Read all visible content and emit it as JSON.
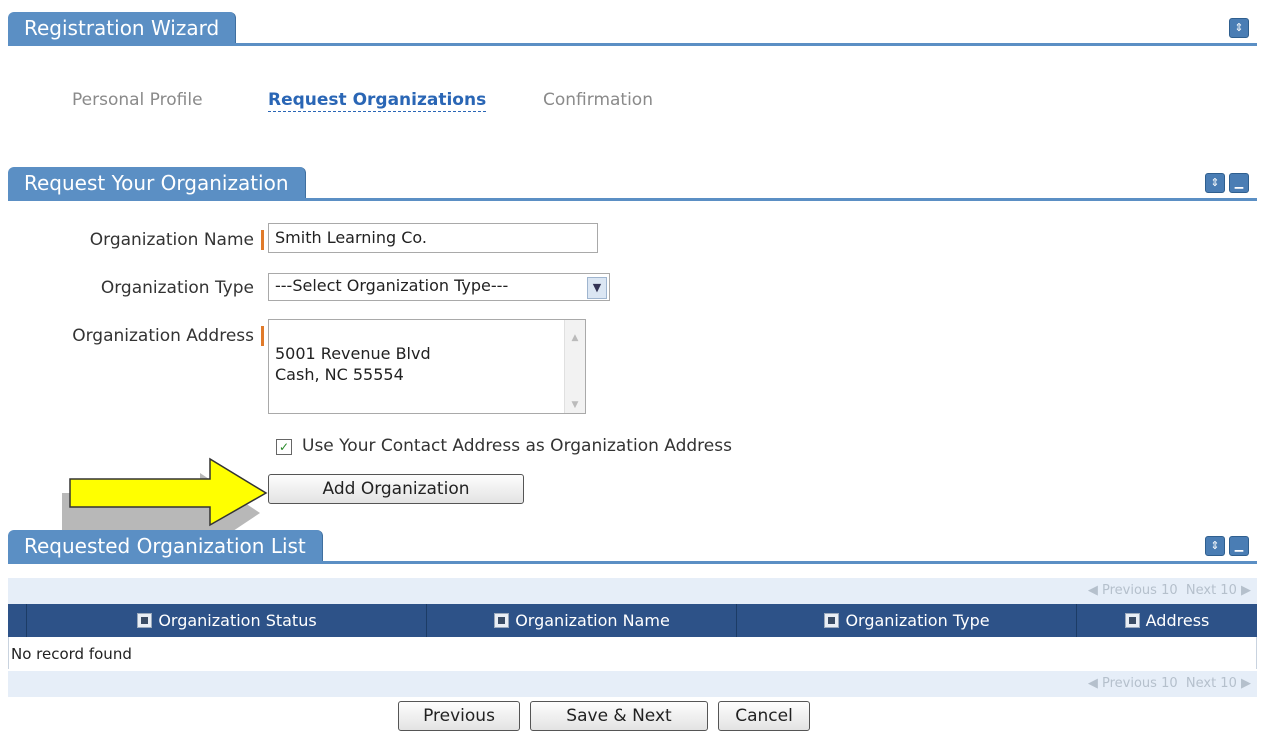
{
  "wizard": {
    "title": "Registration Wizard"
  },
  "steps": [
    {
      "label": "Personal Profile",
      "active": false
    },
    {
      "label": "Request Organizations",
      "active": true
    },
    {
      "label": "Confirmation",
      "active": false
    }
  ],
  "request_panel": {
    "title": "Request Your Organization",
    "name_label": "Organization Name",
    "name_value": "Smith Learning Co.",
    "type_label": "Organization Type",
    "type_value": "---Select Organization Type---",
    "address_label": "Organization Address",
    "address_value": "5001 Revenue Blvd\nCash, NC 55554",
    "use_contact_label": "Use Your Contact Address as Organization Address",
    "use_contact_checked": true,
    "add_button": "Add Organization"
  },
  "list_panel": {
    "title": "Requested Organization List",
    "pager_prev": "Previous 10",
    "pager_next": "Next 10",
    "columns": [
      "Organization Status",
      "Organization Name",
      "Organization Type",
      "Address"
    ],
    "empty_text": "No record found"
  },
  "footer": {
    "previous": "Previous",
    "save_next": "Save & Next",
    "cancel": "Cancel"
  },
  "colors": {
    "header_blue": "#5b8fc4",
    "table_header": "#2d5288",
    "required_marker": "#e07a2a",
    "annotation_arrow": "#ffff00"
  },
  "icons": {
    "collapse": "updown-icon",
    "minimize": "minimize-icon"
  }
}
